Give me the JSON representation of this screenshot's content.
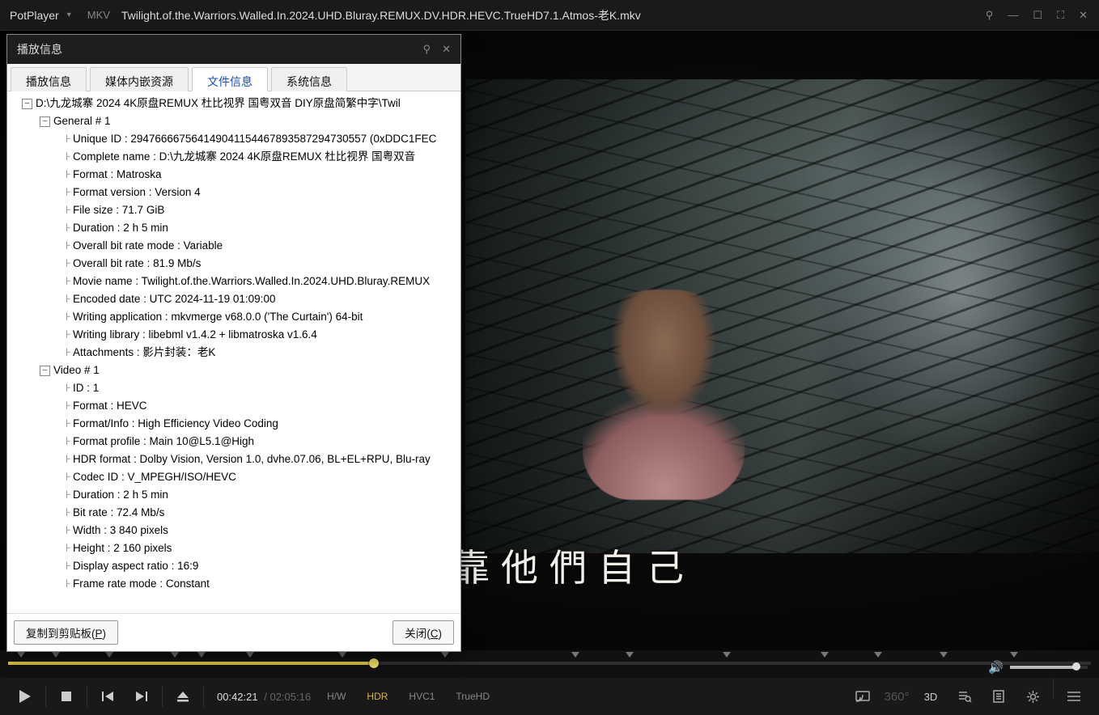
{
  "titlebar": {
    "app": "PotPlayer",
    "format_badge": "MKV",
    "filename": "Twilight.of.the.Warriors.Walled.In.2024.UHD.Bluray.REMUX.DV.HDR.HEVC.TrueHD7.1.Atmos-老K.mkv"
  },
  "info_window": {
    "title": "播放信息",
    "tabs": [
      "播放信息",
      "媒体内嵌资源",
      "文件信息",
      "系统信息"
    ],
    "active_tab_index": 2,
    "root_path": "D:\\九龙城寨 2024 4K原盘REMUX 杜比视界 国粤双音 DIY原盘简繁中字\\Twil",
    "sections": [
      {
        "name": "General # 1",
        "items": [
          "Unique ID : 294766667564149041154467893587294730557 (0xDDC1FEC",
          "Complete name : D:\\九龙城寨 2024 4K原盘REMUX 杜比视界 国粤双音",
          "Format : Matroska",
          "Format version : Version 4",
          "File size : 71.7 GiB",
          "Duration : 2 h 5 min",
          "Overall bit rate mode : Variable",
          "Overall bit rate : 81.9 Mb/s",
          "Movie name : Twilight.of.the.Warriors.Walled.In.2024.UHD.Bluray.REMUX",
          "Encoded date : UTC 2024-11-19 01:09:00",
          "Writing application : mkvmerge v68.0.0 ('The Curtain') 64-bit",
          "Writing library : libebml v1.4.2 + libmatroska v1.6.4",
          "Attachments : 影片封装：老K"
        ]
      },
      {
        "name": "Video # 1",
        "items": [
          "ID : 1",
          "Format : HEVC",
          "Format/Info : High Efficiency Video Coding",
          "Format profile : Main 10@L5.1@High",
          "HDR format : Dolby Vision, Version 1.0, dvhe.07.06, BL+EL+RPU, Blu-ray",
          "Codec ID : V_MPEGH/ISO/HEVC",
          "Duration : 2 h 5 min",
          "Bit rate : 72.4 Mb/s",
          "Width : 3 840 pixels",
          "Height : 2 160 pixels",
          "Display aspect ratio : 16:9",
          "Frame rate mode : Constant"
        ]
      }
    ],
    "buttons": {
      "copy": "复制到剪贴板(",
      "copy_u": "P",
      "close": "关闭(",
      "close_u": "C"
    }
  },
  "subtitle_text": "得靠他們自己",
  "playback": {
    "current": "00:42:21",
    "total": "02:05:16",
    "progress_pct": 33.8,
    "chapter_marks_pct": [
      0.8,
      4,
      9,
      15,
      17.5,
      22,
      30.5,
      40,
      52,
      57,
      66,
      75,
      80,
      86,
      92.5
    ],
    "volume_pct": 85,
    "badges": {
      "hw": "H/W",
      "hdr": "HDR",
      "codec_v": "HVC1",
      "codec_a": "TrueHD"
    }
  },
  "right_ctrl_labels": {
    "threed": "3D",
    "threesixty": "360°"
  }
}
